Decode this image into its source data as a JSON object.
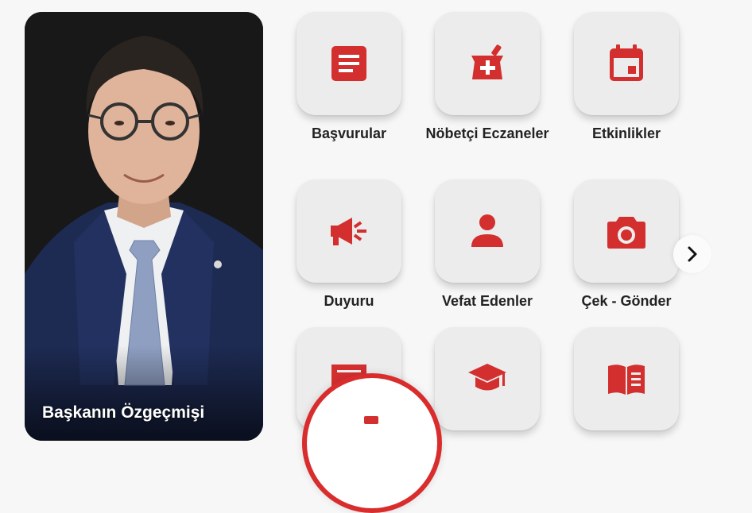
{
  "mayor_card": {
    "title": "Başkanın Özgeçmişi"
  },
  "menu": {
    "items": [
      {
        "label": "Başvurular",
        "icon": "document-icon"
      },
      {
        "label": "Nöbetçi Eczaneler",
        "icon": "pharmacy-icon"
      },
      {
        "label": "Etkinlikler",
        "icon": "calendar-icon"
      },
      {
        "label": "Duyuru",
        "icon": "megaphone-icon"
      },
      {
        "label": "Vefat Edenler",
        "icon": "person-icon"
      },
      {
        "label": "Çek - Gönder",
        "icon": "camera-icon"
      },
      {
        "label": "",
        "icon": "receipt-icon"
      },
      {
        "label": "",
        "icon": "graduation-cap-icon"
      },
      {
        "label": "",
        "icon": "book-icon"
      }
    ]
  },
  "theme": {
    "accent": "#d32f2f",
    "tile_bg": "#ececec",
    "page_bg": "#f7f7f7"
  }
}
